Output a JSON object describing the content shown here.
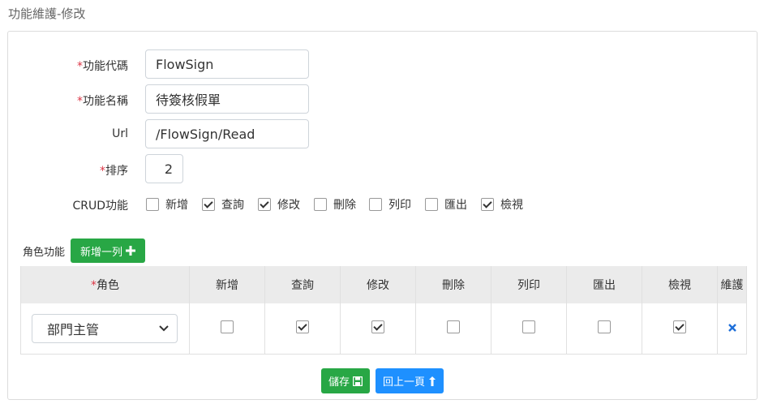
{
  "page": {
    "title": "功能維護-修改"
  },
  "form": {
    "required_mark": "*",
    "code_label": "功能代碼",
    "code_value": "FlowSign",
    "name_label": "功能名稱",
    "name_value": "待簽核假單",
    "url_label": "Url",
    "url_value": "/FlowSign/Read",
    "order_label": "排序",
    "order_value": "2",
    "crud_label": "CRUD功能",
    "crud": [
      {
        "label": "新增",
        "checked": false
      },
      {
        "label": "查詢",
        "checked": true
      },
      {
        "label": "修改",
        "checked": true
      },
      {
        "label": "刪除",
        "checked": false
      },
      {
        "label": "列印",
        "checked": false
      },
      {
        "label": "匯出",
        "checked": false
      },
      {
        "label": "檢視",
        "checked": true
      }
    ]
  },
  "roles": {
    "section_label": "角色功能",
    "add_row_label": "新增一列",
    "headers": [
      "角色",
      "新增",
      "查詢",
      "修改",
      "刪除",
      "列印",
      "匯出",
      "檢視",
      "維護"
    ],
    "rows": [
      {
        "role": "部門主管",
        "perms": [
          false,
          true,
          true,
          false,
          false,
          false,
          true
        ]
      }
    ]
  },
  "actions": {
    "save_label": "儲存",
    "back_label": "回上一頁"
  },
  "colors": {
    "green": "#28a745",
    "blue": "#1e90ff",
    "required": "#dc3545",
    "delete": "#1e6fd9"
  }
}
